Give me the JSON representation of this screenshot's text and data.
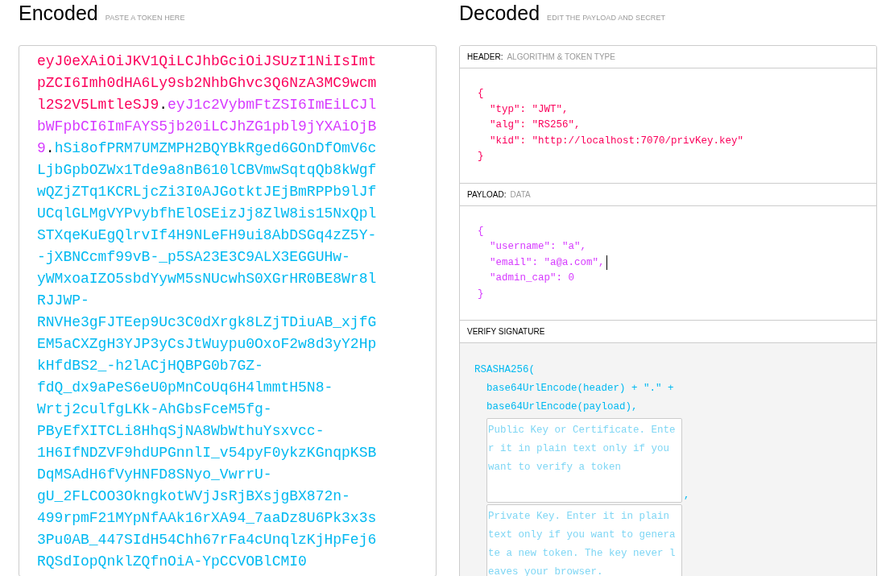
{
  "encoded": {
    "title": "Encoded",
    "subtitle": "PASTE A TOKEN HERE",
    "lines": [
      [
        {
          "kind": "header",
          "text": "eyJ0eXAiOiJKV1QiLCJhbGciOiJSUzI1NiIsImt"
        }
      ],
      [
        {
          "kind": "header",
          "text": "pZCI6Imh0dHA6Ly9sb2NhbGhvc3Q6NzA3MC9wcm"
        }
      ],
      [
        {
          "kind": "header",
          "text": "l2S2V5LmtleSJ9"
        },
        {
          "kind": "dot",
          "text": "."
        },
        {
          "kind": "payload",
          "text": "eyJ1c2VybmFtZSI6ImEiLCJl"
        }
      ],
      [
        {
          "kind": "payload",
          "text": "bWFpbCI6ImFAYS5jb20iLCJhZG1pbl9jYXAiOjB"
        }
      ],
      [
        {
          "kind": "payload",
          "text": "9"
        },
        {
          "kind": "dot",
          "text": "."
        },
        {
          "kind": "signature",
          "text": "hSi8ofPRM7UMZMPH2BQYBkRged6GOnDfOmV6c"
        }
      ],
      [
        {
          "kind": "signature",
          "text": "LjbGpbOZWx1Tde9a8nB610lCBVmwSqtqQb8kWgf"
        }
      ],
      [
        {
          "kind": "signature",
          "text": "wQZjZTq1KCRLjcZi3I0AJGotktJEjBmRPPb9lJf"
        }
      ],
      [
        {
          "kind": "signature",
          "text": "UCqlGLMgVYPvybfhElOSEizJj8ZlW8is15NxQpl"
        }
      ],
      [
        {
          "kind": "signature",
          "text": "STXqeKuEgQlrvIf4H9NLeFH9ui8AbDSGq4zZ5Y-"
        }
      ],
      [
        {
          "kind": "signature",
          "text": "-jXBNCcmf99vB-_p5SA23E3C9ALX3EGGUHw-"
        }
      ],
      [
        {
          "kind": "signature",
          "text": "yWMxoaIZO5sbdYywM5sNUcwhS0XGrHR0BE8Wr8l"
        }
      ],
      [
        {
          "kind": "signature",
          "text": "RJJWP-"
        }
      ],
      [
        {
          "kind": "signature",
          "text": "RNVHe3gFJTEep9Uc3C0dXrgk8LZjTDiuAB_xjfG"
        }
      ],
      [
        {
          "kind": "signature",
          "text": "EM5aCXZgH3YJP3yCsJtWuypu0OxoF2w8d3yY2Hp"
        }
      ],
      [
        {
          "kind": "signature",
          "text": "kHfdBS2_-h2lACjHQBPG0b7GZ-"
        }
      ],
      [
        {
          "kind": "signature",
          "text": "fdQ_dx9aPeS6eU0pMnCoUq6H4lmmtH5N8-"
        }
      ],
      [
        {
          "kind": "signature",
          "text": "Wrtj2culfgLKk-AhGbsFceM5fg-"
        }
      ],
      [
        {
          "kind": "signature",
          "text": "PByEfXITCLi8HhqSjNA8WbWthuYsxvcc-"
        }
      ],
      [
        {
          "kind": "signature",
          "text": "1H6IfNDZVF9hdUPGnnlI_v54pyF0ykzKGnqpKSB"
        }
      ],
      [
        {
          "kind": "signature",
          "text": "DqMSAdH6fVyHNFD8SNyo_VwrrU-"
        }
      ],
      [
        {
          "kind": "signature",
          "text": "gU_2FLCOO3OkngkotWVjJsRjBXsjgBX872n-"
        }
      ],
      [
        {
          "kind": "signature",
          "text": "499rpmF21MYpNfAAk16rXA94_7aaDz8U6Pk3x3s"
        }
      ],
      [
        {
          "kind": "signature",
          "text": "3Pu0AB_447SIdH54Chh67rFa4cUnqlzKjHpFej6"
        }
      ],
      [
        {
          "kind": "signature",
          "text": "RQSdIopQnklZQfnOiA-YpCCVOBlCMI0"
        }
      ]
    ]
  },
  "decoded": {
    "title": "Decoded",
    "subtitle": "EDIT THE PAYLOAD AND SECRET",
    "sections": [
      {
        "kind": "code",
        "color": "#fb015b",
        "label": "HEADER:",
        "sublabel": "ALGORITHM & TOKEN TYPE",
        "open": "{",
        "close": "}",
        "entries": [
          {
            "text": "\"typ\": \"JWT\",",
            "caret": false
          },
          {
            "text": "\"alg\": \"RS256\",",
            "caret": false
          },
          {
            "text": "\"kid\": \"http://localhost:7070/privKey.key\"",
            "caret": false
          }
        ]
      },
      {
        "kind": "code",
        "color": "#d63aff",
        "label": "PAYLOAD:",
        "sublabel": "DATA",
        "open": "{",
        "close": "}",
        "entries": [
          {
            "text": "\"username\": \"a\",",
            "caret": false
          },
          {
            "text": "\"email\": \"a@a.com\",",
            "caret": true
          },
          {
            "text": "\"admin_cap\": 0",
            "caret": false
          }
        ]
      },
      {
        "kind": "verify",
        "color": "#00b9f1",
        "label": "VERIFY SIGNATURE",
        "call": "RSASHA256(",
        "args": [
          "base64UrlEncode(header) + \".\" +",
          "base64UrlEncode(payload),"
        ],
        "fields": [
          {
            "placeholder": "Public Key or Certificate. Enter it in plain text only if you want to verify a token",
            "suffix": ","
          },
          {
            "placeholder": "Private Key. Enter it in plain text only if you want to generate a new token. The key never leaves your browser."
          }
        ]
      }
    ]
  }
}
